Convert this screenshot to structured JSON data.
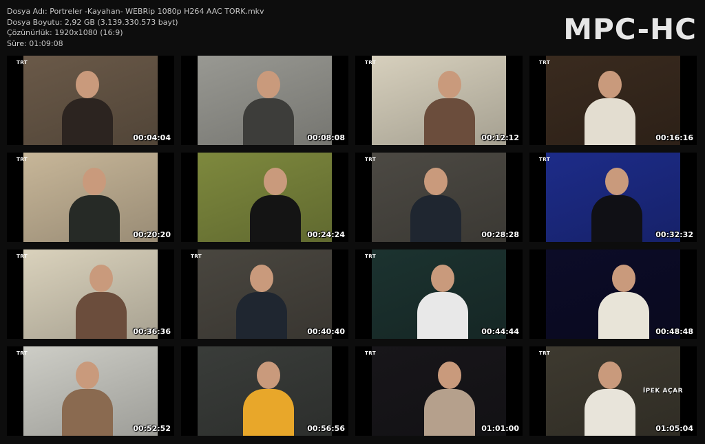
{
  "file_info": {
    "name_line": "Dosya Adı: Portreler -Kayahan- WEBRip 1080p H264 AAC TORK.mkv",
    "size_line": "Dosya Boyutu: 2,92 GB (3.139.330.573 bayt)",
    "resolution_line": "Çözünürlük: 1920x1080 (16:9)",
    "duration_line": "Süre: 01:09:08"
  },
  "logo": "MPC-HC",
  "thumbnails": [
    {
      "ts": "00:04:04",
      "channel": "TRT",
      "bg": "#6b5a49",
      "fg": "#2c2420"
    },
    {
      "ts": "00:08:08",
      "channel": "",
      "bg": "#9a9a94",
      "fg": "#3d3d3a"
    },
    {
      "ts": "00:12:12",
      "channel": "TRT",
      "bg": "#d9d2bf",
      "fg": "#6b4d3c"
    },
    {
      "ts": "00:16:16",
      "channel": "TRT",
      "bg": "#3a2b1f",
      "fg": "#e3ddd0"
    },
    {
      "ts": "00:20:20",
      "channel": "TRT",
      "bg": "#c9b89a",
      "fg": "#262a26"
    },
    {
      "ts": "00:24:24",
      "channel": "",
      "bg": "#7f8a3e",
      "fg": "#141414"
    },
    {
      "ts": "00:28:28",
      "channel": "TRT",
      "bg": "#4d4a44",
      "fg": "#1f2630"
    },
    {
      "ts": "00:32:32",
      "channel": "TRT",
      "bg": "#1d2c8a",
      "fg": "#101015"
    },
    {
      "ts": "00:36:36",
      "channel": "TRT",
      "bg": "#dcd4be",
      "fg": "#6b4d3c"
    },
    {
      "ts": "00:40:40",
      "channel": "TRT",
      "bg": "#4a4740",
      "fg": "#1f2630"
    },
    {
      "ts": "00:44:44",
      "channel": "TRT",
      "bg": "#1c3330",
      "fg": "#e8e8e8"
    },
    {
      "ts": "00:48:48",
      "channel": "",
      "bg": "#0c0c28",
      "fg": "#e8e4d8"
    },
    {
      "ts": "00:52:52",
      "channel": "TRT",
      "bg": "#cfcfc8",
      "fg": "#8a6a50"
    },
    {
      "ts": "00:56:56",
      "channel": "",
      "bg": "#3a3d3a",
      "fg": "#e8a72a"
    },
    {
      "ts": "01:01:00",
      "channel": "TRT",
      "bg": "#18161a",
      "fg": "#b5a08c"
    },
    {
      "ts": "01:05:04",
      "channel": "TRT",
      "bg": "#3e3a30",
      "fg": "#e8e4da",
      "caption": "İPEK AÇAR"
    }
  ]
}
